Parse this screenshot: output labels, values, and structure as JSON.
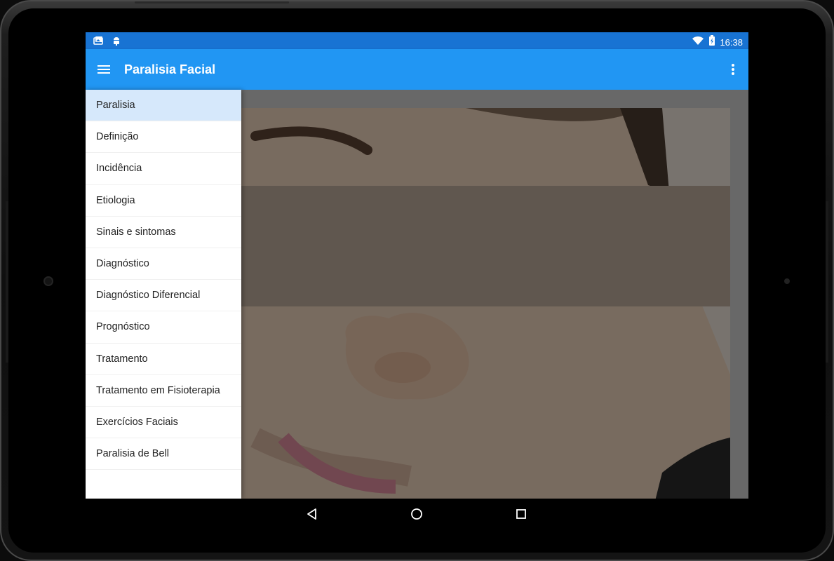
{
  "statusbar": {
    "time": "16:38",
    "left_icons": [
      "photo-icon",
      "android-icon"
    ],
    "right_icons": [
      "wifi-icon",
      "battery-icon"
    ]
  },
  "appbar": {
    "title": "Paralisia Facial",
    "menu_icon": "menu-icon",
    "overflow_icon": "more-vert-icon"
  },
  "drawer": {
    "selected_index": 0,
    "items": [
      {
        "label": "Paralisia"
      },
      {
        "label": "Definição"
      },
      {
        "label": "Incidência"
      },
      {
        "label": "Etiologia"
      },
      {
        "label": "Sinais e sintomas"
      },
      {
        "label": "Diagnóstico"
      },
      {
        "label": "Diagnóstico Diferencial"
      },
      {
        "label": "Prognóstico"
      },
      {
        "label": "Tratamento"
      },
      {
        "label": "Tratamento em Fisioterapia"
      },
      {
        "label": "Exercícios Faciais"
      },
      {
        "label": "Paralisia de Bell"
      }
    ]
  },
  "colors": {
    "statusbar": "#1873d3",
    "appbar": "#2196f3",
    "drawer_selected": "#d6e8fb"
  },
  "navbar": {
    "icons": [
      "back-icon",
      "home-icon",
      "recents-icon"
    ]
  }
}
